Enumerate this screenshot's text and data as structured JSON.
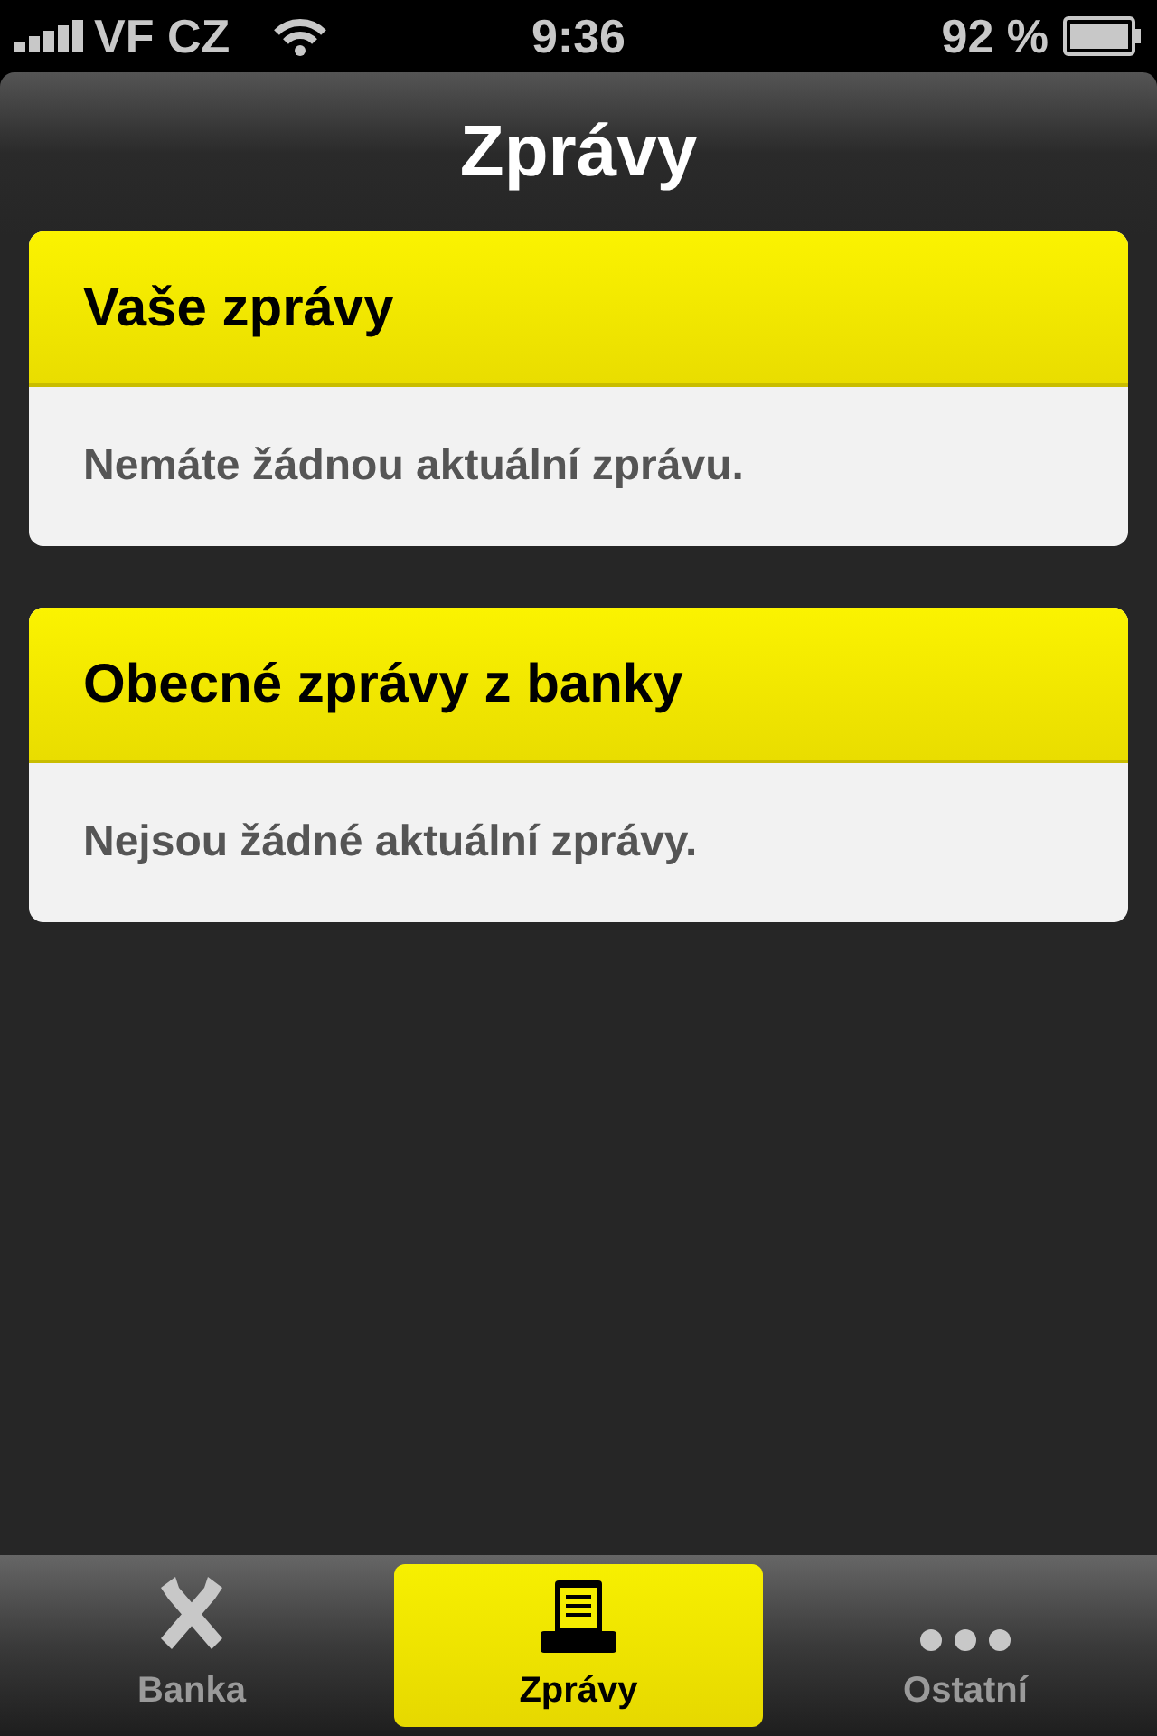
{
  "status_bar": {
    "carrier": "VF CZ",
    "time": "9:36",
    "battery": "92 %"
  },
  "title": "Zprávy",
  "sections": [
    {
      "title": "Vaše zprávy",
      "message": "Nemáte žádnou aktuální zprávu."
    },
    {
      "title": "Obecné zprávy z banky",
      "message": "Nejsou žádné aktuální zprávy."
    }
  ],
  "tabs": [
    {
      "label": "Banka",
      "kind": "bank",
      "selected": false
    },
    {
      "label": "Zprávy",
      "kind": "messages",
      "selected": true
    },
    {
      "label": "Ostatní",
      "kind": "more",
      "selected": false
    }
  ]
}
